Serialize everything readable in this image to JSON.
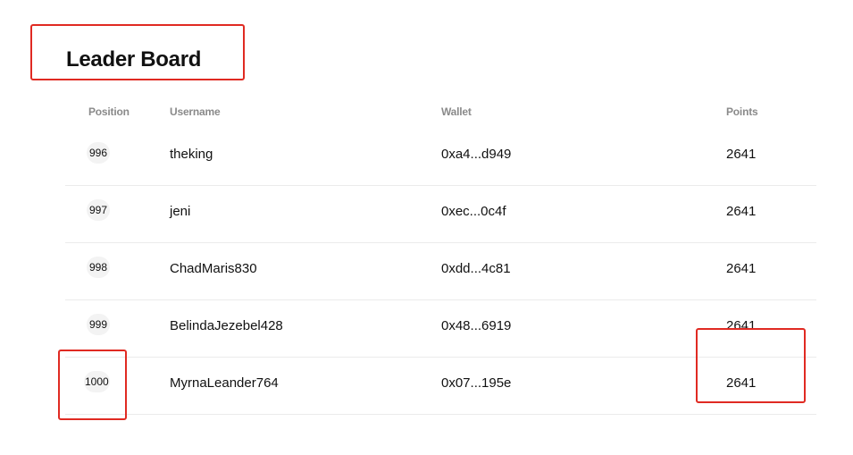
{
  "page": {
    "title": "Leader Board"
  },
  "table": {
    "headers": {
      "position": "Position",
      "username": "Username",
      "wallet": "Wallet",
      "points": "Points"
    },
    "rows": [
      {
        "position": "996",
        "username": "theking",
        "wallet": "0xa4...d949",
        "points": "2641"
      },
      {
        "position": "997",
        "username": "jeni",
        "wallet": "0xec...0c4f",
        "points": "2641"
      },
      {
        "position": "998",
        "username": "ChadMaris830",
        "wallet": "0xdd...4c81",
        "points": "2641"
      },
      {
        "position": "999",
        "username": "BelindaJezebel428",
        "wallet": "0x48...6919",
        "points": "2641"
      },
      {
        "position": "1000",
        "username": "MyrnaLeander764",
        "wallet": "0x07...195e",
        "points": "2641"
      }
    ]
  },
  "colors": {
    "annotation": "#e02a22",
    "header_text": "#8a8a8a",
    "divider": "#ebebeb",
    "badge_bg": "#f3f3f3"
  }
}
